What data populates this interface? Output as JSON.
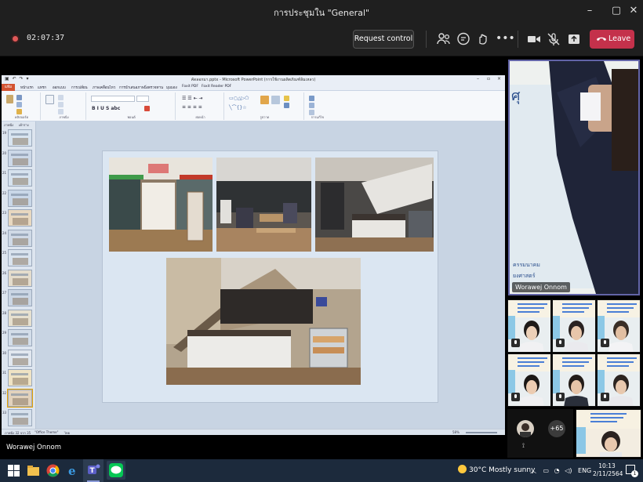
{
  "window": {
    "title": "การประชุมใน \"General\""
  },
  "meeting": {
    "timer": "02:07:37",
    "request_control_label": "Request control",
    "leave_label": "Leave"
  },
  "ppt": {
    "title": "คัดลอกมา.pptx - Microsoft PowerPoint (การใช้งานผลิตภัณฑ์ล้มเหลว)",
    "tabs": [
      "แฟ้ม",
      "หน้าแรก",
      "แทรก",
      "ออกแบบ",
      "การเปลี่ยน",
      "ภาพเคลื่อนไหว",
      "การนำเสนอภาพนิ่ง",
      "ตรวจทาน",
      "มุมมอง",
      "Foxit PDF",
      "Foxit Reader PDF"
    ],
    "ribbon_groups": [
      "คลิปบอร์ด",
      "ภาพนิ่ง",
      "ฟอนต์",
      "ย่อหน้า",
      "รูปวาด",
      "การแก้ไข"
    ],
    "pane_tabs": [
      "ภาพนิ่ง",
      "เค้าร่าง"
    ],
    "slide_numbers": [
      "19",
      "20",
      "21",
      "22",
      "23",
      "24",
      "25",
      "26",
      "27",
      "28",
      "29",
      "30",
      "31",
      "32",
      "33"
    ],
    "status": {
      "slide_info": "ภาพนิ่ง 32 จาก 35",
      "theme": "\"Office Theme\"",
      "language": "ไทย",
      "zoom": "58%"
    }
  },
  "participants": {
    "presenter_name": "Worawej Onnom",
    "main_video_name": "Worawej Onnom",
    "overflow_count": "+65"
  },
  "taskbar": {
    "weather": "30°C  Mostly sunny",
    "language": "ENG",
    "time": "10:13",
    "date": "2/11/2564"
  }
}
